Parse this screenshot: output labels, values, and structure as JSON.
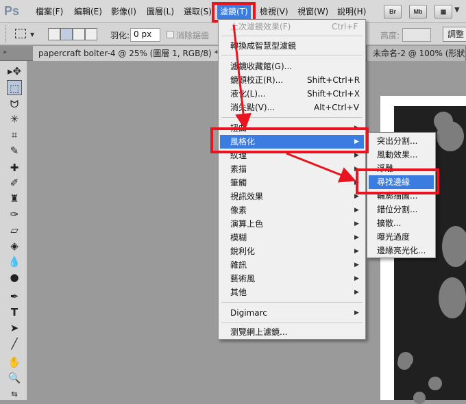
{
  "app": {
    "logo": "Ps"
  },
  "menubar": {
    "items": [
      "檔案(F)",
      "編輯(E)",
      "影像(I)",
      "圖層(L)",
      "選取(S)",
      "濾鏡(T)",
      "檢視(V)",
      "視窗(W)",
      "說明(H)"
    ],
    "active": "濾鏡(T)",
    "buttons": [
      "Br",
      "Mb"
    ]
  },
  "options": {
    "feather_label": "羽化:",
    "feather_value": "0 px",
    "antialias_label": "消除鋸齒",
    "height_label": "高度:",
    "adjust_button": "調整"
  },
  "tabs": [
    "papercraft bolter-4 @ 25% (圖層 1, RGB/8) *",
    "未命名-2 @ 100% (形狀"
  ],
  "filter_menu": {
    "items": [
      {
        "label": "上次濾鏡效果(F)",
        "shortcut": "Ctrl+F",
        "disabled": true
      },
      {
        "label": "轉換成智慧型濾鏡"
      },
      {
        "label": "濾鏡收藏館(G)..."
      },
      {
        "label": "鏡頭校正(R)...",
        "shortcut": "Shift+Ctrl+R"
      },
      {
        "label": "液化(L)...",
        "shortcut": "Shift+Ctrl+X"
      },
      {
        "label": "消失點(V)...",
        "shortcut": "Alt+Ctrl+V"
      },
      {
        "label": "扭曲",
        "submenu": true
      },
      {
        "label": "風格化",
        "submenu": true,
        "highlighted": true
      },
      {
        "label": "紋理",
        "submenu": true
      },
      {
        "label": "素描",
        "submenu": true
      },
      {
        "label": "筆觸",
        "submenu": true
      },
      {
        "label": "視訊效果",
        "submenu": true
      },
      {
        "label": "像素",
        "submenu": true
      },
      {
        "label": "演算上色",
        "submenu": true
      },
      {
        "label": "模糊",
        "submenu": true
      },
      {
        "label": "銳利化",
        "submenu": true
      },
      {
        "label": "雜訊",
        "submenu": true
      },
      {
        "label": "藝術風",
        "submenu": true
      },
      {
        "label": "其他",
        "submenu": true
      },
      {
        "label": "Digimarc",
        "submenu": true
      },
      {
        "label": "瀏覽網上濾鏡..."
      }
    ]
  },
  "stylize_submenu": {
    "items": [
      {
        "label": "突出分割..."
      },
      {
        "label": "風動效果..."
      },
      {
        "label": "浮雕..."
      },
      {
        "label": "尋找邊緣",
        "highlighted": true
      },
      {
        "label": "輪廓描圖..."
      },
      {
        "label": "錯位分割..."
      },
      {
        "label": "擴散..."
      },
      {
        "label": "曝光過度"
      },
      {
        "label": "邊緣亮光化..."
      }
    ]
  },
  "colors": {
    "highlight": "#3b7ce0",
    "annotation": "#e8141f"
  }
}
